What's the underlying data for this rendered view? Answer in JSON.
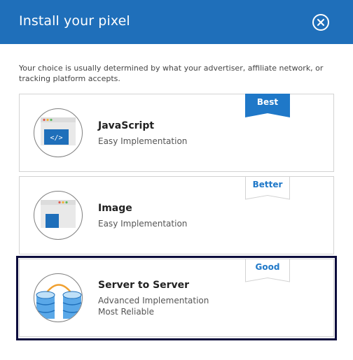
{
  "dialog": {
    "title": "Install your pixel",
    "intro": "Your choice is usually determined by what your advertiser, affiliate network, or tracking platform accepts."
  },
  "options": [
    {
      "title": "JavaScript",
      "subtitle": "Easy Implementation",
      "badge": "Best",
      "icon": "javascript-code-icon",
      "selected": false
    },
    {
      "title": "Image",
      "subtitle": "Easy Implementation",
      "badge": "Better",
      "icon": "image-pixel-icon",
      "selected": false
    },
    {
      "title": "Server to Server",
      "subtitle": "Advanced Implementation",
      "subtitle2": "Most Reliable",
      "badge": "Good",
      "icon": "server-to-server-icon",
      "selected": true
    }
  ],
  "colors": {
    "header": "#1f6fba",
    "accent": "#1f78c8",
    "selected_border": "#0c0c3c"
  }
}
